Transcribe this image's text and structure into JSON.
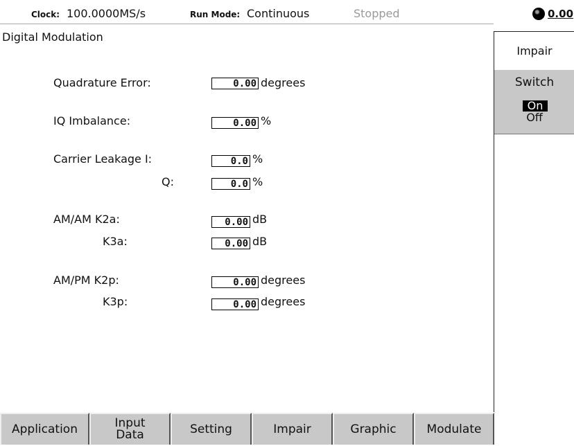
{
  "topbar": {
    "clock_label": "Clock:",
    "clock_value": "100.0000MS/s",
    "runmode_label": "Run Mode:",
    "runmode_value": "Continuous",
    "status": "Stopped",
    "knob_value": "0.00"
  },
  "main": {
    "title": "Digital Modulation",
    "quad_label": "Quadrature Error:",
    "quad_value": "0.00",
    "quad_unit": "degrees",
    "iq_label": "IQ Imbalance:",
    "iq_value": "0.00",
    "iq_unit": "%",
    "carrier_label": "Carrier Leakage I:",
    "carrier_i_value": "0.0",
    "carrier_i_unit": "%",
    "carrier_q_label": "Q:",
    "carrier_q_value": "0.0",
    "carrier_q_unit": "%",
    "amam_label": "AM/AM K2a:",
    "amam_k2a_value": "0.00",
    "amam_k2a_unit": "dB",
    "amam_k3a_label": "K3a:",
    "amam_k3a_value": "0.00",
    "amam_k3a_unit": "dB",
    "ampm_label": "AM/PM K2p:",
    "ampm_k2p_value": "0.00",
    "ampm_k2p_unit": "degrees",
    "ampm_k3p_label": "K3p:",
    "ampm_k3p_value": "0.00",
    "ampm_k3p_unit": "degrees"
  },
  "side": {
    "title": "Impair",
    "switch_label": "Switch",
    "option_on": "On",
    "option_off": "Off",
    "selected": "On"
  },
  "tabs": [
    {
      "label": "Application"
    },
    {
      "label": "Input",
      "label2": "Data"
    },
    {
      "label": "Setting"
    },
    {
      "label": "Impair"
    },
    {
      "label": "Graphic"
    },
    {
      "label": "Modulate"
    }
  ]
}
